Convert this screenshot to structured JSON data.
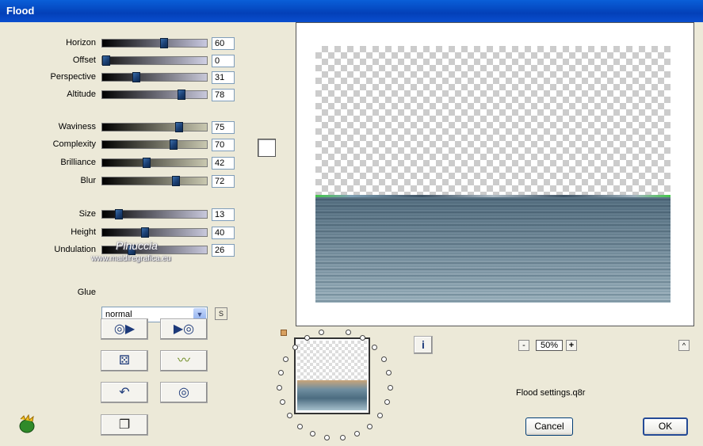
{
  "window": {
    "title": "Flood"
  },
  "sliders": [
    {
      "label": "Horizon",
      "value": "60",
      "percent": 60
    },
    {
      "label": "Offset",
      "value": "0",
      "percent": 0
    },
    {
      "label": "Perspective",
      "value": "31",
      "percent": 31
    },
    {
      "label": "Altitude",
      "value": "78",
      "percent": 78
    },
    {
      "label": "Waviness",
      "value": "75",
      "percent": 75
    },
    {
      "label": "Complexity",
      "value": "70",
      "percent": 70
    },
    {
      "label": "Brilliance",
      "value": "42",
      "percent": 42
    },
    {
      "label": "Blur",
      "value": "72",
      "percent": 72
    },
    {
      "label": "Size",
      "value": "13",
      "percent": 13
    },
    {
      "label": "Height",
      "value": "40",
      "percent": 40
    },
    {
      "label": "Undulation",
      "value": "26",
      "percent": 26
    }
  ],
  "glue": {
    "label": "Glue",
    "selected": "normal",
    "s_button": "S"
  },
  "watermark": {
    "name": "Pinuccia",
    "site": "www.maidiregrafica.eu"
  },
  "zoom": {
    "minus": "-",
    "value": "50%",
    "plus": "+"
  },
  "info_icon": "i",
  "collapse_icon": "^",
  "settings_file": "Flood settings.q8r",
  "buttons": {
    "cancel": "Cancel",
    "ok": "OK"
  },
  "colors": {
    "title_bar": "#0a5fd8",
    "dialog_bg": "#ece9d8",
    "accent": "#1d3a7a"
  }
}
